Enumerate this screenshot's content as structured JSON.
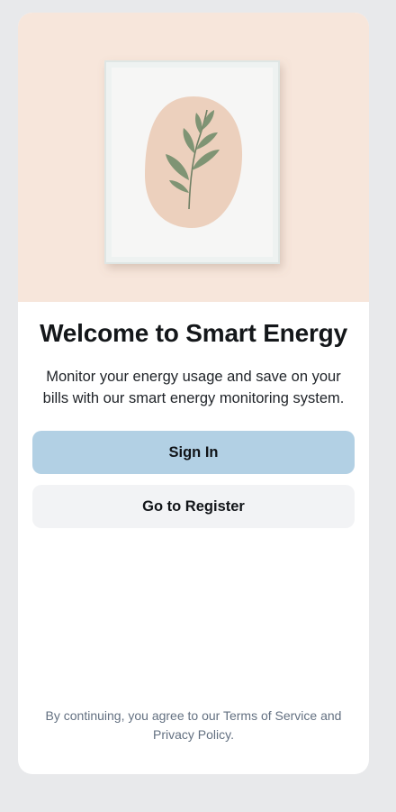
{
  "hero": {
    "illustration": "framed-leaf-artwork-icon",
    "background_color": "#f7e6db"
  },
  "welcome": {
    "title": "Welcome to Smart Energy",
    "subtitle": "Monitor your energy usage and save on your bills with our smart energy monitoring system."
  },
  "actions": {
    "sign_in_label": "Sign In",
    "register_label": "Go to Register",
    "primary_color": "#b2d0e4",
    "secondary_color": "#f2f3f5"
  },
  "legal": {
    "text": "By continuing, you agree to our Terms of Service and Privacy Policy."
  }
}
